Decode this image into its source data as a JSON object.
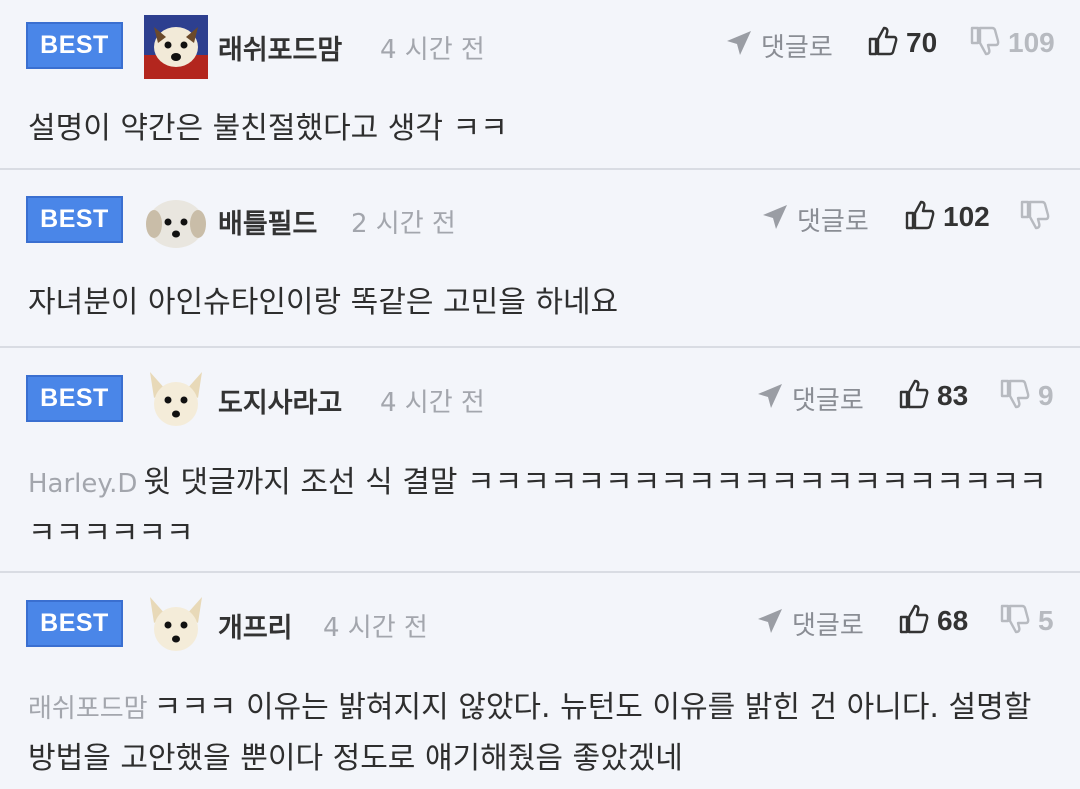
{
  "comments": [
    {
      "badge": "BEST",
      "nickname": "래쉬포드맘",
      "time": "4 시간 전",
      "reply_label": "댓글로",
      "likes": "70",
      "dislikes": "109",
      "mention": "",
      "text": "설명이 약간은 불친절했다고 생각 ㅋㅋ"
    },
    {
      "badge": "BEST",
      "nickname": "배틀필드",
      "time": "2 시간 전",
      "reply_label": "댓글로",
      "likes": "102",
      "dislikes": "",
      "mention": "",
      "text": "자녀분이 아인슈타인이랑 똑같은 고민을 하네요"
    },
    {
      "badge": "BEST",
      "nickname": "도지사라고",
      "time": "4 시간 전",
      "reply_label": "댓글로",
      "likes": "83",
      "dislikes": "9",
      "mention": "Harley.D",
      "text": "윗 댓글까지 조선 식 결말 ㅋㅋㅋㅋㅋㅋㅋㅋㅋㅋㅋㅋㅋㅋㅋㅋㅋㅋㅋㅋㅋㅋㅋㅋㅋㅋㅋ"
    },
    {
      "badge": "BEST",
      "nickname": "개프리",
      "time": "4 시간 전",
      "reply_label": "댓글로",
      "likes": "68",
      "dislikes": "5",
      "mention": "래쉬포드맘",
      "text": "ㅋㅋㅋ 이유는 밝혀지지 않았다. 뉴턴도 이유를 밝힌 건 아니다. 설명할 방법을 고안했을 뿐이다 정도로 얘기해줬음 좋았겠네"
    }
  ],
  "icons": {
    "reply": "send-arrow-icon",
    "like": "thumbs-up-icon",
    "dislike": "thumbs-down-icon"
  },
  "colors": {
    "best_badge": "#4a86e8",
    "background": "#f3f5fa",
    "divider": "#d9dce3"
  }
}
